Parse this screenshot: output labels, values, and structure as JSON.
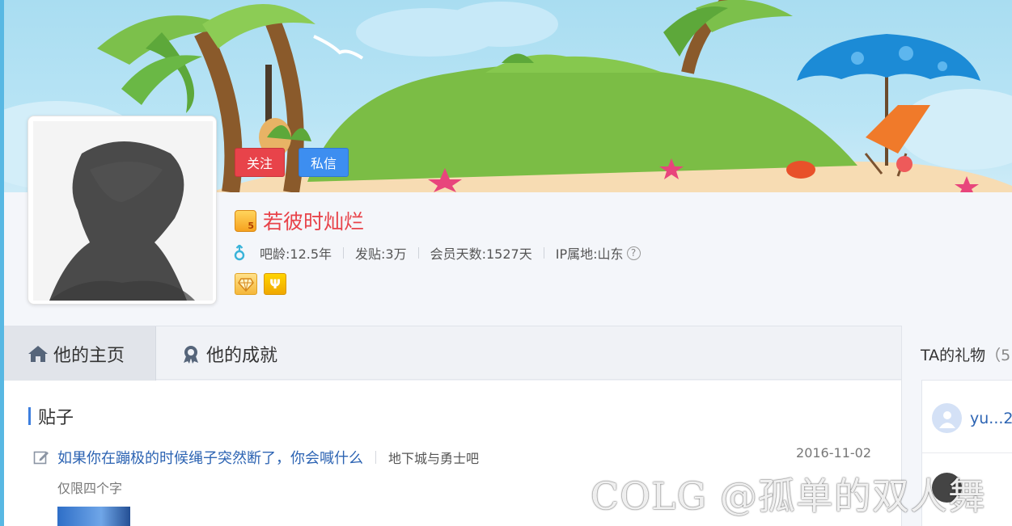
{
  "profile": {
    "follow_label": "关注",
    "message_label": "私信",
    "username": "若彼时灿烂",
    "level_badge": "5",
    "stats": {
      "age": "吧龄:12.5年",
      "posts": "发贴:3万",
      "member_days": "会员天数:1527天",
      "ip_location": "IP属地:山东"
    },
    "help_symbol": "?",
    "badge_b_symbol": "Ψ"
  },
  "tabs": {
    "home": "他的主页",
    "achievements": "他的成就"
  },
  "posts_section": {
    "title": "贴子",
    "items": [
      {
        "title": "如果你在蹦极的时候绳子突然断了，你会喊什么",
        "forum": "地下城与勇士吧",
        "date": "2016-11-02",
        "excerpt": "仅限四个字"
      }
    ]
  },
  "sidebar": {
    "gifts_title": "TA的礼物",
    "gifts_count": "（5",
    "gifts": [
      {
        "name": "yu...2"
      },
      {
        "name": ""
      }
    ]
  },
  "watermark": "COLG @孤单的双人舞",
  "colors": {
    "follow": "#e8434a",
    "message": "#3d8ef0",
    "username": "#e8434a",
    "link": "#2d64b3",
    "accent": "#3d7ede"
  },
  "icons": [
    "home-icon",
    "medal-icon",
    "edit-icon",
    "male-icon",
    "help-icon"
  ]
}
